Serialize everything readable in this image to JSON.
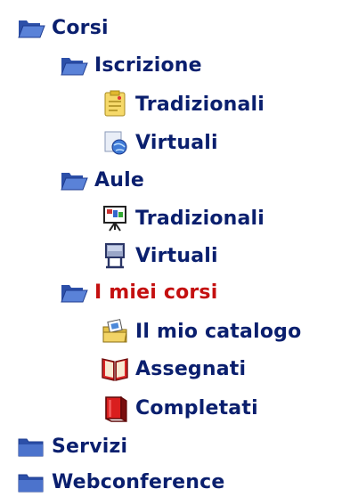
{
  "menu": {
    "corsi": {
      "label": "Corsi",
      "icon": "folder-open-icon"
    },
    "iscrizione": {
      "label": "Iscrizione",
      "icon": "folder-open-icon"
    },
    "iscrizione_tradizionali": {
      "label": "Tradizionali",
      "icon": "note-pad-icon"
    },
    "iscrizione_virtuali": {
      "label": "Virtuali",
      "icon": "globe-icon"
    },
    "aule": {
      "label": "Aule",
      "icon": "folder-open-icon"
    },
    "aule_tradizionali": {
      "label": "Tradizionali",
      "icon": "easel-board-icon"
    },
    "aule_virtuali": {
      "label": "Virtuali",
      "icon": "monitor-stand-icon"
    },
    "miei_corsi": {
      "label": "I miei corsi",
      "icon": "folder-open-icon",
      "active": true
    },
    "catalogo": {
      "label": "Il mio catalogo",
      "icon": "folder-images-icon"
    },
    "assegnati": {
      "label": "Assegnati",
      "icon": "open-book-icon"
    },
    "completati": {
      "label": "Completati",
      "icon": "closed-book-icon"
    },
    "servizi": {
      "label": "Servizi",
      "icon": "folder-closed-icon"
    },
    "webconference": {
      "label": "Webconference",
      "icon": "folder-closed-icon"
    }
  },
  "colors": {
    "link": "#0a1f6e",
    "active": "#c41010"
  }
}
